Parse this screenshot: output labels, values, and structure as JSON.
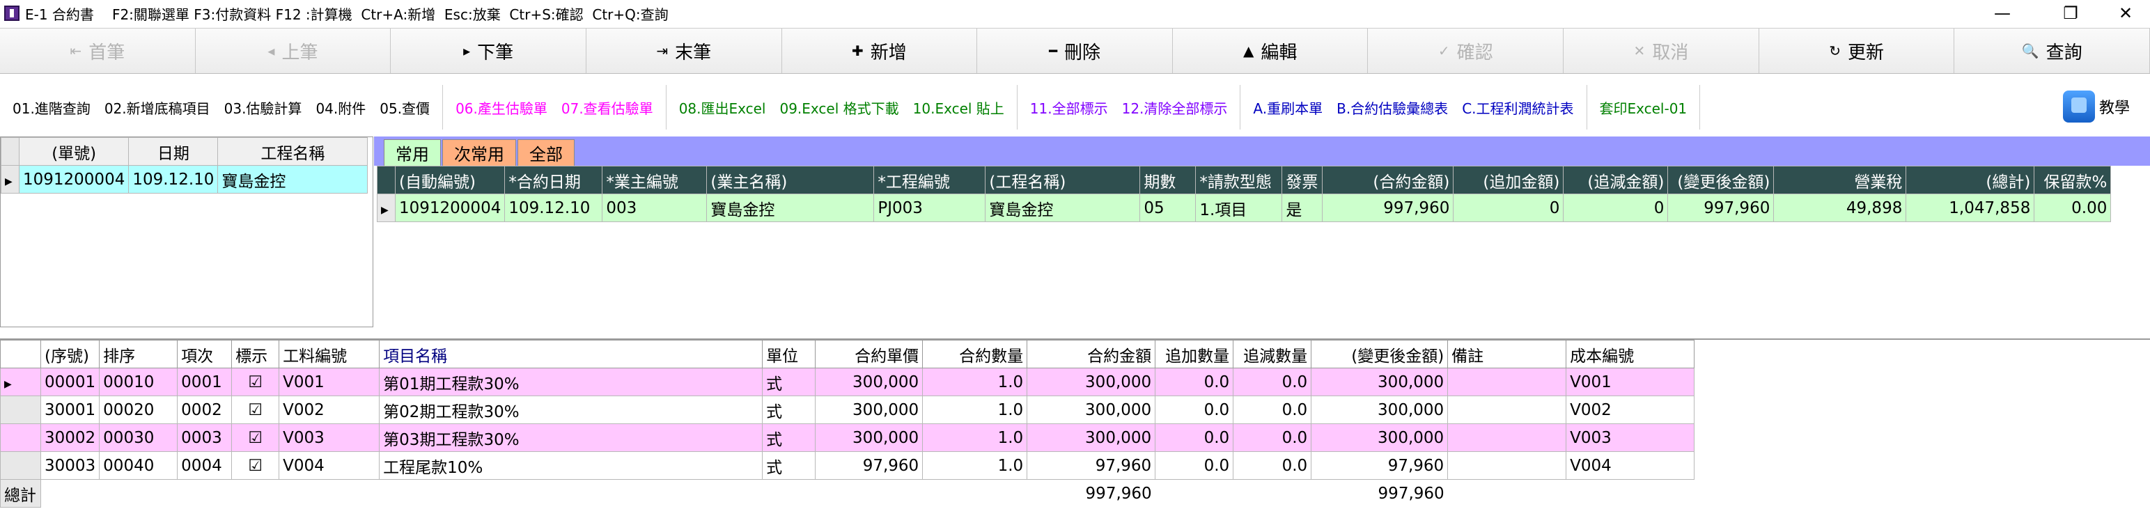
{
  "window": {
    "title": "E-1 合約書",
    "hints": "F2:關聯選單 F3:付款資料 F12 :計算機  Ctr+A:新增  Esc:放棄  Ctr+S:確認  Ctr+Q:查詢"
  },
  "toolbar": [
    {
      "icon": "⇤",
      "label": "首筆",
      "enabled": false
    },
    {
      "icon": "◂",
      "label": "上筆",
      "enabled": false
    },
    {
      "icon": "▸",
      "label": "下筆",
      "enabled": true
    },
    {
      "icon": "⇥",
      "label": "末筆",
      "enabled": true
    },
    {
      "icon": "✚",
      "label": "新增",
      "enabled": true
    },
    {
      "icon": "━",
      "label": "刪除",
      "enabled": true
    },
    {
      "icon": "▲",
      "label": "編輯",
      "enabled": true
    },
    {
      "icon": "✓",
      "label": "確認",
      "enabled": false
    },
    {
      "icon": "✕",
      "label": "取消",
      "enabled": false
    },
    {
      "icon": "↻",
      "label": "更新",
      "enabled": true
    },
    {
      "icon": "🔍",
      "label": "查詢",
      "enabled": true
    }
  ],
  "functions": {
    "g1": [
      "01.進階查詢",
      "02.新增底稿項目",
      "03.估驗計算",
      "04.附件",
      "05.查價"
    ],
    "g2": [
      "06.產生估驗單",
      "07.查看估驗單"
    ],
    "g3": [
      "08.匯出Excel",
      "09.Excel 格式下載",
      "10.Excel 貼上"
    ],
    "g4": [
      "11.全部標示",
      "12.清除全部標示"
    ],
    "g5": [
      "A.重刷本單",
      "B.合約估驗彙總表",
      "C.工程利潤統計表"
    ],
    "g6": [
      "套印Excel-01"
    ],
    "help": "教學",
    "colors": {
      "g1": "#000000",
      "g2": "#ff00ff",
      "g3": "#008000",
      "g4": "#8000ff",
      "g5": "#0000c0",
      "g6": "#008000"
    }
  },
  "left_grid": {
    "headers": [
      "(單號)",
      "日期",
      "工程名稱"
    ],
    "rows": [
      [
        "1091200004",
        "109.12.10",
        "寶島金控"
      ]
    ]
  },
  "tabs": [
    {
      "label": "常用",
      "bg": "#c8ffc8"
    },
    {
      "label": "次常用",
      "bg": "#ffb080"
    },
    {
      "label": "全部",
      "bg": "#ffb080"
    }
  ],
  "main_grid": {
    "headers": [
      "(自動編號)",
      "*合約日期",
      "*業主編號",
      "(業主名稱)",
      "*工程編號",
      "(工程名稱)",
      "期數",
      "*請款型態",
      "發票",
      "(合約金額)",
      "(追加金額)",
      "(追減金額)",
      "(變更後金額)",
      "營業稅",
      "(總計)",
      "保留款%"
    ],
    "rows": [
      [
        "1091200004",
        "109.12.10",
        "003",
        "寶島金控",
        "PJ003",
        "寶島金控",
        "05",
        "1.項目",
        "是",
        "997,960",
        "0",
        "0",
        "997,960",
        "49,898",
        "1,047,858",
        "0.00"
      ]
    ]
  },
  "detail_grid": {
    "headers": [
      "(序號)",
      "排序",
      "項次",
      "標示",
      "工料編號",
      "項目名稱",
      "單位",
      "合約單價",
      "合約數量",
      "合約金額",
      "追加數量",
      "追減數量",
      "(變更後金額)",
      "備註",
      "成本編號"
    ],
    "rows": [
      [
        "00001",
        "00010",
        "0001",
        "☑",
        "V001",
        "第01期工程款30%",
        "式",
        "300,000",
        "1.0",
        "300,000",
        "0.0",
        "0.0",
        "300,000",
        "",
        "V001"
      ],
      [
        "30001",
        "00020",
        "0002",
        "☑",
        "V002",
        "第02期工程款30%",
        "式",
        "300,000",
        "1.0",
        "300,000",
        "0.0",
        "0.0",
        "300,000",
        "",
        "V002"
      ],
      [
        "30002",
        "00030",
        "0003",
        "☑",
        "V003",
        "第03期工程款30%",
        "式",
        "300,000",
        "1.0",
        "300,000",
        "0.0",
        "0.0",
        "300,000",
        "",
        "V003"
      ],
      [
        "30003",
        "00040",
        "0004",
        "☑",
        "V004",
        "工程尾款10%",
        "式",
        "97,960",
        "1.0",
        "97,960",
        "0.0",
        "0.0",
        "97,960",
        "",
        "V004"
      ]
    ],
    "total_label": "總計",
    "total_contract": "997,960",
    "total_changed": "997,960"
  }
}
